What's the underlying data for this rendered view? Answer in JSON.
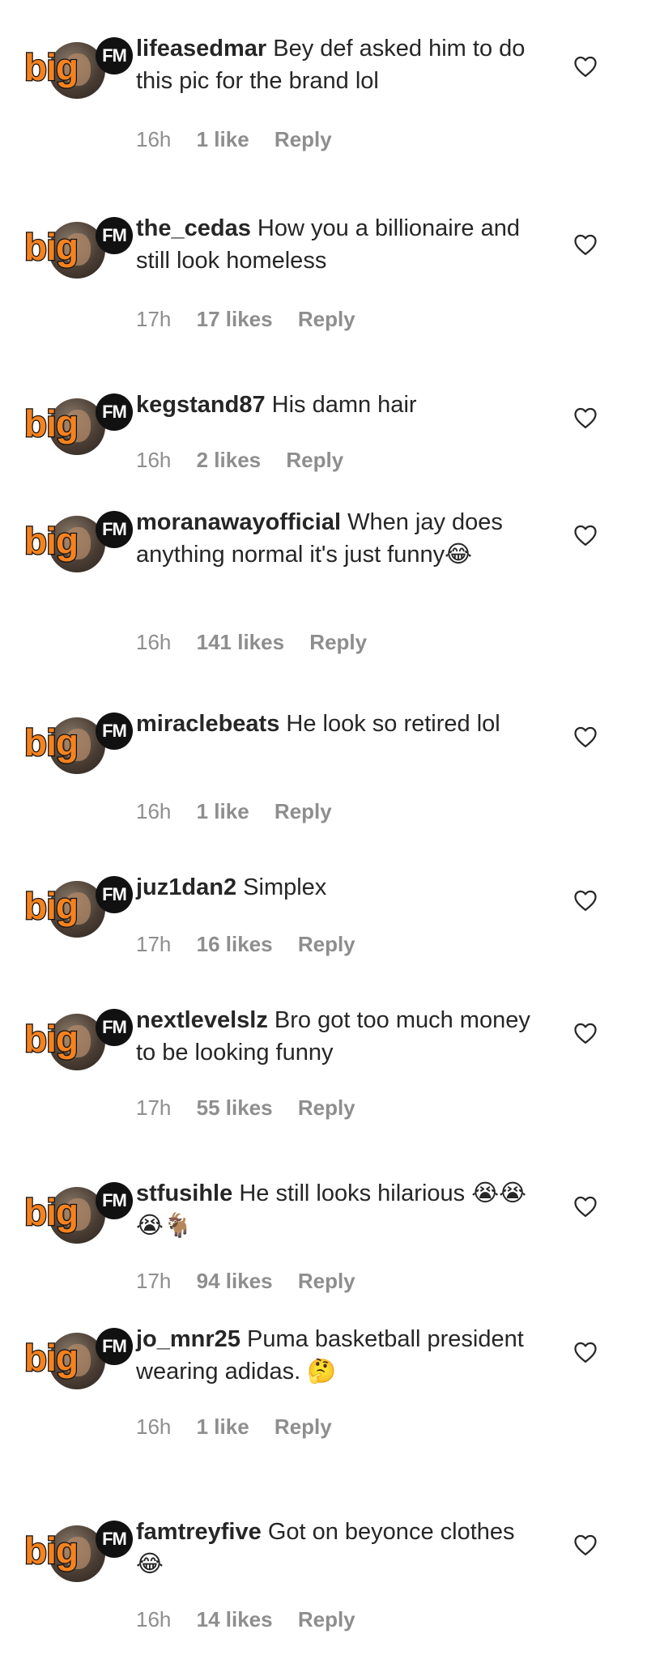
{
  "brand": {
    "logo_text": "big",
    "logo_badge": "FM",
    "logo_color": "#f4821f"
  },
  "comments": [
    {
      "username": "lifeasedmar",
      "text": "Bey def asked him to do this pic for the brand lol",
      "time": "16h",
      "likes": "1 like",
      "reply": "Reply"
    },
    {
      "username": "the_cedas",
      "text": "How you a billionaire and still look homeless",
      "time": "17h",
      "likes": "17 likes",
      "reply": "Reply"
    },
    {
      "username": "kegstand87",
      "text": "His damn hair",
      "time": "16h",
      "likes": "2 likes",
      "reply": "Reply"
    },
    {
      "username": "moranawayofficial",
      "text": "When jay does anything normal it's just funny😂",
      "time": "16h",
      "likes": "141 likes",
      "reply": "Reply"
    },
    {
      "username": "miraclebeats",
      "text": "He look so retired lol",
      "time": "16h",
      "likes": "1 like",
      "reply": "Reply"
    },
    {
      "username": "juz1dan2",
      "text": "Simplex",
      "time": "17h",
      "likes": "16 likes",
      "reply": "Reply"
    },
    {
      "username": "nextlevelslz",
      "text": "Bro got too much money to be looking funny",
      "time": "17h",
      "likes": "55 likes",
      "reply": "Reply"
    },
    {
      "username": "stfusihle",
      "text": "He still looks hilarious 😭😭😭🐐",
      "time": "17h",
      "likes": "94 likes",
      "reply": "Reply"
    },
    {
      "username": "jo_mnr25",
      "text": "Puma basketball president wearing adidas. 🤔",
      "time": "16h",
      "likes": "1 like",
      "reply": "Reply"
    },
    {
      "username": "famtreyfive",
      "text": "Got on beyonce clothes 😂",
      "time": "16h",
      "likes": "14 likes",
      "reply": "Reply"
    }
  ]
}
